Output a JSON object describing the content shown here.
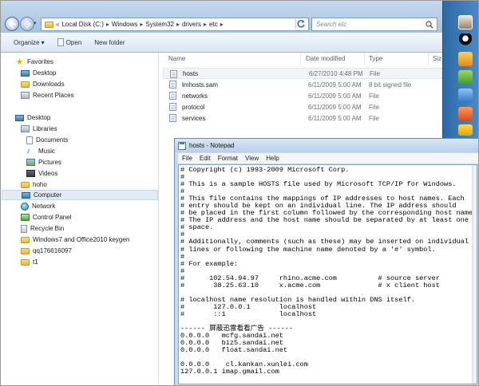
{
  "explorer": {
    "address": {
      "prefix": "«",
      "crumbs": [
        "Local Disk (C:)",
        "Windows",
        "System32",
        "drivers",
        "etc"
      ],
      "separator": "▸"
    },
    "search_placeholder": "Search etc",
    "toolbar": {
      "organize": "Organize ▾",
      "open": "Open",
      "new_folder": "New folder"
    },
    "nav": {
      "favorites": "Favorites",
      "desktop_fav": "Desktop",
      "downloads": "Downloads",
      "recent": "Recent Places",
      "desktop": "Desktop",
      "libraries": "Libraries",
      "documents": "Documents",
      "music": "Music",
      "pictures": "Pictures",
      "videos": "Videos",
      "hoho": "hoho",
      "computer": "Computer",
      "network": "Network",
      "control_panel": "Control Panel",
      "recycle": "Recycle Bin",
      "win7": "Windows7 and Office2010 keygen",
      "qq": "qq176616097",
      "t1": "t1"
    },
    "columns": {
      "name": "Name",
      "date": "Date modified",
      "type": "Type",
      "size": "Siz"
    },
    "files": [
      {
        "name": "hosts",
        "date": "6/27/2010 4:48 PM",
        "type": "File"
      },
      {
        "name": "lmhosts.sam",
        "date": "6/11/2009 5:00 AM",
        "type": "8 bit signed file"
      },
      {
        "name": "networks",
        "date": "6/11/2009 5:00 AM",
        "type": "File"
      },
      {
        "name": "protocol",
        "date": "6/11/2009 5:00 AM",
        "type": "File"
      },
      {
        "name": "services",
        "date": "6/11/2009 5:00 AM",
        "type": "File"
      }
    ]
  },
  "notepad": {
    "title": "hosts - Notepad",
    "menu": {
      "file": "File",
      "edit": "Edit",
      "format": "Format",
      "view": "View",
      "help": "Help"
    },
    "content": "# Copyright (c) 1993-2009 Microsoft Corp.\n#\n# This is a sample HOSTS file used by Microsoft TCP/IP for Windows.\n#\n# This file contains the mappings of IP addresses to host names. Each\n# entry should be kept on an individual line. The IP address should\n# be placed in the first column followed by the corresponding host name.\n# The IP address and the host name should be separated by at least one\n# space.\n#\n# Additionally, comments (such as these) may be inserted on individual\n# lines or following the machine name denoted by a '#' symbol.\n#\n# For example:\n#\n#      102.54.94.97     rhino.acme.com          # source server\n#       38.25.63.10     x.acme.com              # x client host\n\n# localhost name resolution is handled within DNS itself.\n#\t127.0.0.1       localhost\n#\t::1             localhost\n\n------ 屏蔽迅雷看看广告 ------\n0.0.0.0   mcfg.sandai.net\n0.0.0.0   biz5.sandai.net\n0.0.0.0   float.sandai.net\n\n0.0.0.0    cl.kankan.xunlei.com\n127.0.0.1 imap.gmail.com"
  },
  "taskbar": {
    "icons": [
      "avatar-icon",
      "qq-penguin-icon",
      "app-icon-1",
      "app-icon-2",
      "app-icon-3",
      "app-icon-4",
      "app-icon-5",
      "app-icon-6"
    ]
  }
}
